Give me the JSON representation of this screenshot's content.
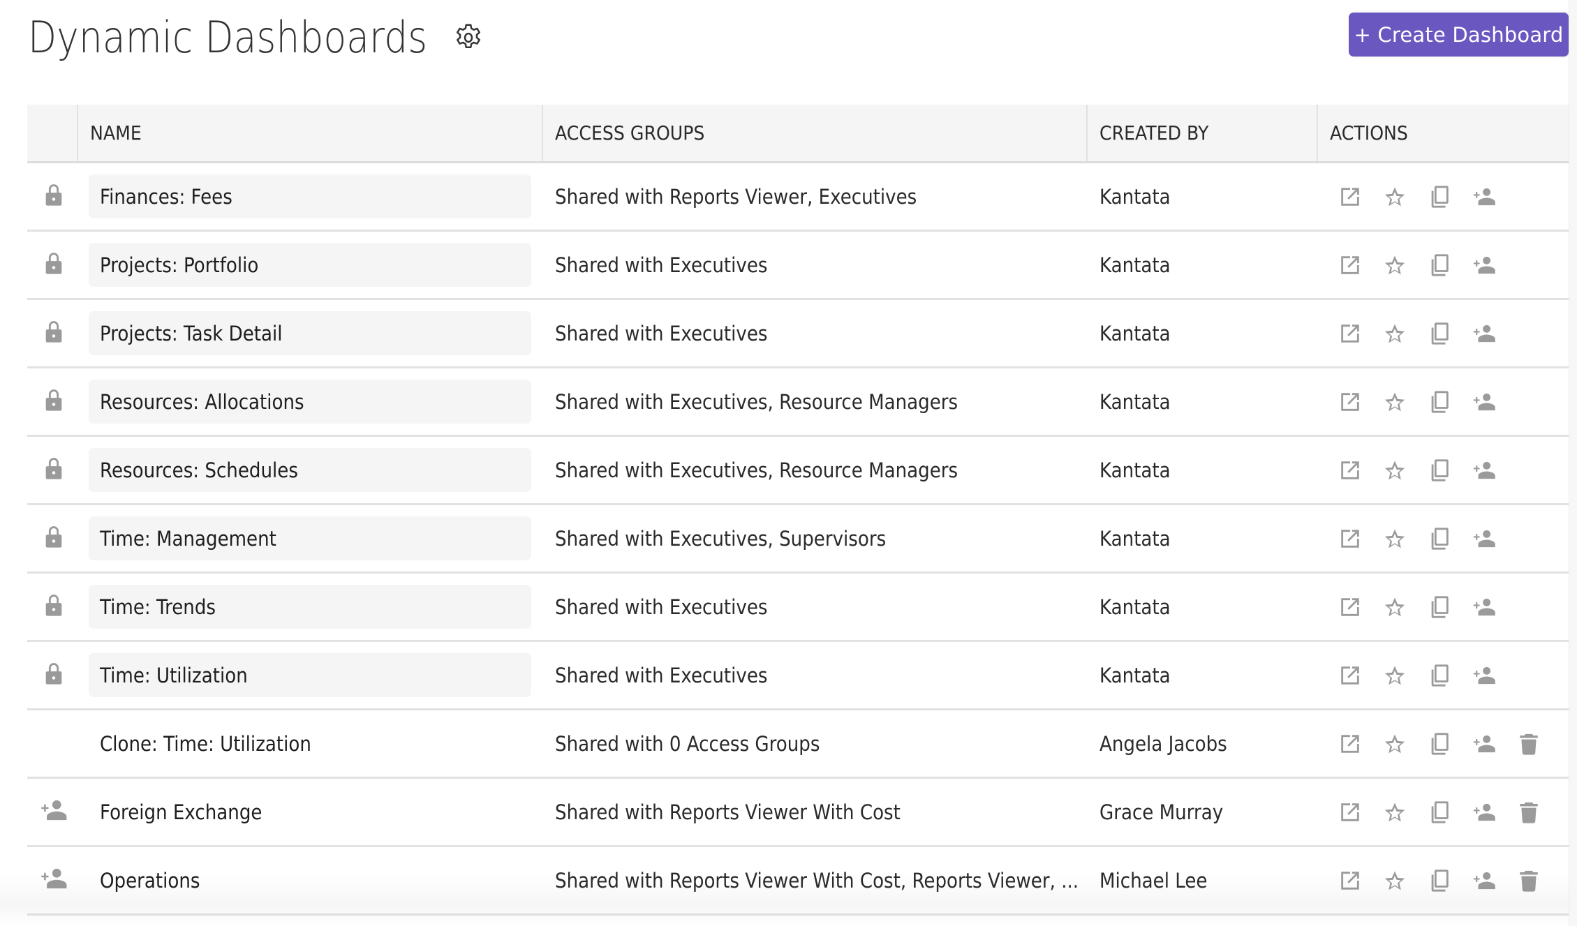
{
  "header": {
    "title": "Dynamic Dashboards",
    "settings_icon": "gear-icon",
    "create_button_label": "+ Create Dashboard",
    "accent_color": "#6b57c0"
  },
  "table": {
    "columns": [
      {
        "key": "status",
        "label": ""
      },
      {
        "key": "name",
        "label": "NAME"
      },
      {
        "key": "access",
        "label": "ACCESS GROUPS"
      },
      {
        "key": "created_by",
        "label": "CREATED BY"
      },
      {
        "key": "actions",
        "label": "ACTIONS"
      }
    ],
    "rows": [
      {
        "status_icon": "lock-icon",
        "locked": true,
        "name": "Finances: Fees",
        "access": "Shared with Reports Viewer, Executives",
        "created_by": "Kantata",
        "actions": [
          "open-external-icon",
          "star-icon",
          "copy-icon",
          "person-add-icon"
        ]
      },
      {
        "status_icon": "lock-icon",
        "locked": true,
        "name": "Projects: Portfolio",
        "access": "Shared with Executives",
        "created_by": "Kantata",
        "actions": [
          "open-external-icon",
          "star-icon",
          "copy-icon",
          "person-add-icon"
        ]
      },
      {
        "status_icon": "lock-icon",
        "locked": true,
        "name": "Projects: Task Detail",
        "access": "Shared with Executives",
        "created_by": "Kantata",
        "actions": [
          "open-external-icon",
          "star-icon",
          "copy-icon",
          "person-add-icon"
        ]
      },
      {
        "status_icon": "lock-icon",
        "locked": true,
        "name": "Resources: Allocations",
        "access": "Shared with Executives, Resource Managers",
        "created_by": "Kantata",
        "actions": [
          "open-external-icon",
          "star-icon",
          "copy-icon",
          "person-add-icon"
        ]
      },
      {
        "status_icon": "lock-icon",
        "locked": true,
        "name": "Resources: Schedules",
        "access": "Shared with Executives, Resource Managers",
        "created_by": "Kantata",
        "actions": [
          "open-external-icon",
          "star-icon",
          "copy-icon",
          "person-add-icon"
        ]
      },
      {
        "status_icon": "lock-icon",
        "locked": true,
        "name": "Time: Management",
        "access": "Shared with Executives, Supervisors",
        "created_by": "Kantata",
        "actions": [
          "open-external-icon",
          "star-icon",
          "copy-icon",
          "person-add-icon"
        ]
      },
      {
        "status_icon": "lock-icon",
        "locked": true,
        "name": "Time: Trends",
        "access": "Shared with Executives",
        "created_by": "Kantata",
        "actions": [
          "open-external-icon",
          "star-icon",
          "copy-icon",
          "person-add-icon"
        ]
      },
      {
        "status_icon": "lock-icon",
        "locked": true,
        "name": "Time: Utilization",
        "access": "Shared with Executives",
        "created_by": "Kantata",
        "actions": [
          "open-external-icon",
          "star-icon",
          "copy-icon",
          "person-add-icon"
        ]
      },
      {
        "status_icon": "",
        "locked": false,
        "name": "Clone: Time: Utilization",
        "access": "Shared with 0 Access Groups",
        "created_by": "Angela Jacobs",
        "actions": [
          "open-external-icon",
          "star-icon",
          "copy-icon",
          "person-add-icon",
          "trash-icon"
        ]
      },
      {
        "status_icon": "person-add-icon",
        "locked": false,
        "name": "Foreign Exchange",
        "access": "Shared with Reports Viewer With Cost",
        "created_by": "Grace Murray",
        "actions": [
          "open-external-icon",
          "star-icon",
          "copy-icon",
          "person-add-icon",
          "trash-icon"
        ]
      },
      {
        "status_icon": "person-add-icon",
        "locked": false,
        "name": "Operations",
        "access": "Shared with Reports Viewer With Cost, Reports Viewer, ...",
        "created_by": "Michael Lee",
        "actions": [
          "open-external-icon",
          "star-icon",
          "copy-icon",
          "person-add-icon",
          "trash-icon"
        ]
      }
    ]
  }
}
